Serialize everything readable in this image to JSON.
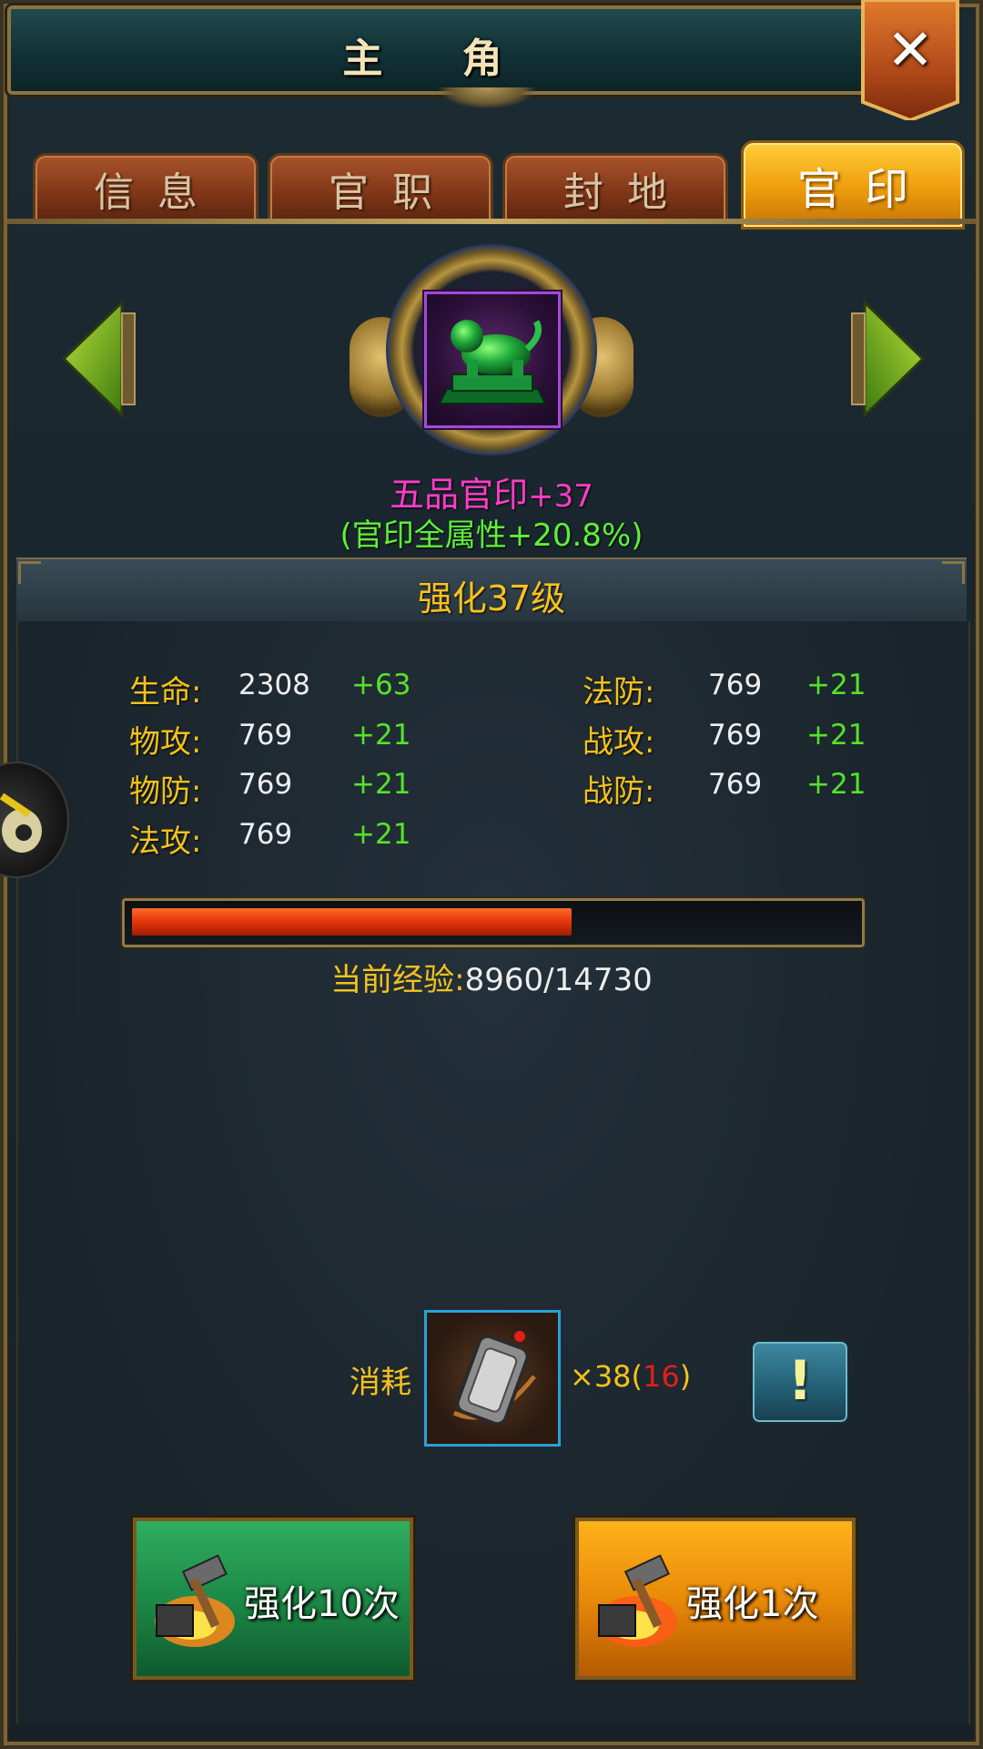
{
  "window": {
    "title": "主 角",
    "close_label": "✕"
  },
  "tabs": [
    {
      "label": "信息",
      "active": false
    },
    {
      "label": "官职",
      "active": false
    },
    {
      "label": "封地",
      "active": false
    },
    {
      "label": "官印",
      "active": true
    }
  ],
  "seal": {
    "name": "五品官印",
    "level_suffix": "+37",
    "attribute_bonus": "(官印全属性+20.8%)",
    "icon": "jade-beast-seal-icon"
  },
  "enhance": {
    "level_label": "强化37级"
  },
  "stats_left": [
    {
      "key": "生命:",
      "value": "2308",
      "delta": "+63"
    },
    {
      "key": "物攻:",
      "value": "769",
      "delta": "+21"
    },
    {
      "key": "物防:",
      "value": "769",
      "delta": "+21"
    },
    {
      "key": "法攻:",
      "value": "769",
      "delta": "+21"
    }
  ],
  "stats_right": [
    {
      "key": "法防:",
      "value": "769",
      "delta": "+21"
    },
    {
      "key": "战攻:",
      "value": "769",
      "delta": "+21"
    },
    {
      "key": "战防:",
      "value": "769",
      "delta": "+21"
    }
  ],
  "experience": {
    "label": "当前经验:",
    "value": "8960/14730",
    "current": 8960,
    "max": 14730
  },
  "consume": {
    "label": "消耗",
    "item_icon": "seal-token-icon",
    "count": "×38",
    "owned_open": "(",
    "owned": "16",
    "owned_close": ")",
    "info_label": "!"
  },
  "buttons": {
    "enhance10": "强化10次",
    "enhance1": "强化1次"
  },
  "colors": {
    "gold_text": "#f4c21c",
    "green_delta": "#55e22a",
    "item_name": "#ff3dc8",
    "exp_fill": "#e63a0c",
    "active_tab": "#f0a10e"
  }
}
